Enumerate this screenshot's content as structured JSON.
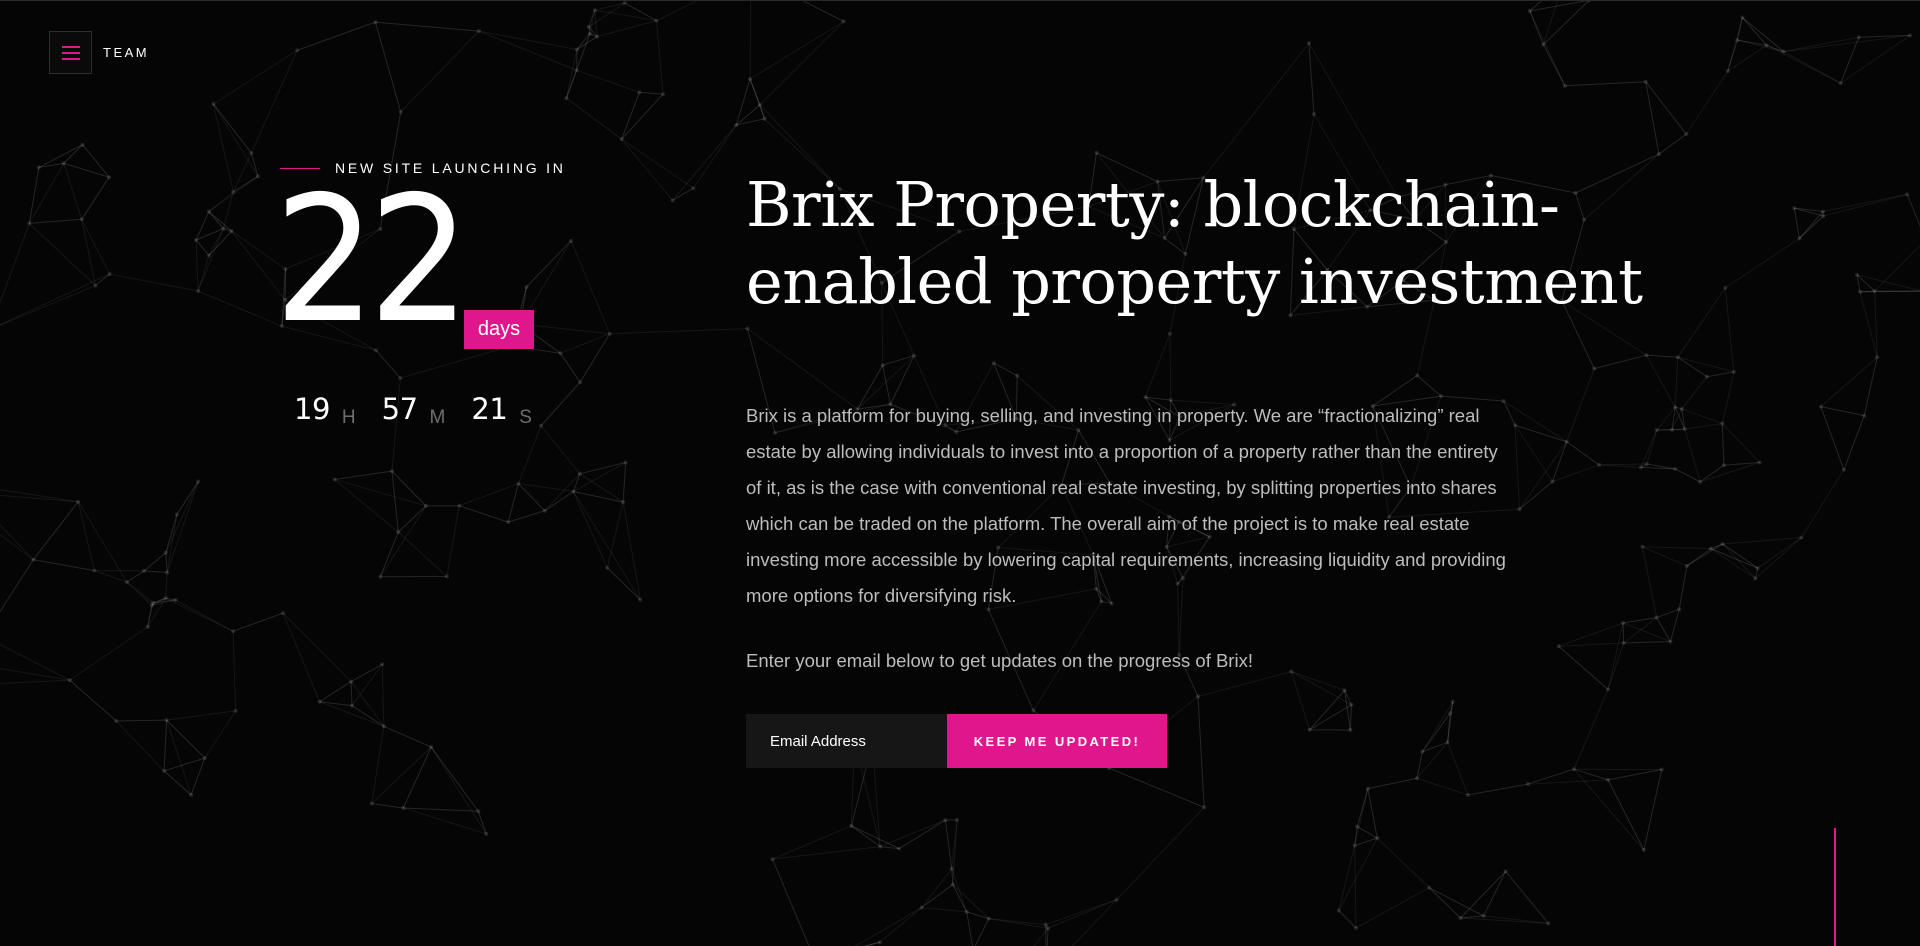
{
  "header": {
    "menu_icon": "hamburger-icon",
    "team_label": "TEAM"
  },
  "countdown": {
    "launch_label": "NEW SITE LAUNCHING IN",
    "days": "22",
    "days_label": "days",
    "hours": "19",
    "hours_label": "H",
    "minutes": "57",
    "minutes_label": "M",
    "seconds": "21",
    "seconds_label": "S"
  },
  "main": {
    "title": "Brix Property: blockchain-enabled property investment",
    "description": "Brix is a platform for buying, selling, and investing in property. We are “fractionalizing” real estate by allowing individuals to invest into a proportion of a property rather than the entirety of it, as is the case with conventional real estate investing, by splitting properties into shares which can be traded on the platform. The overall aim of the project is to make real estate investing more accessible by lowering capital requirements, increasing liquidity and providing more options for diversifying risk.",
    "cta_text": "Enter your email below to get updates on the progress of Brix!"
  },
  "form": {
    "email_placeholder": "Email Address",
    "submit_label": "KEEP ME UPDATED!"
  },
  "colors": {
    "accent": "#e0168c",
    "background": "#050505",
    "body_text": "#bdbdbd"
  }
}
